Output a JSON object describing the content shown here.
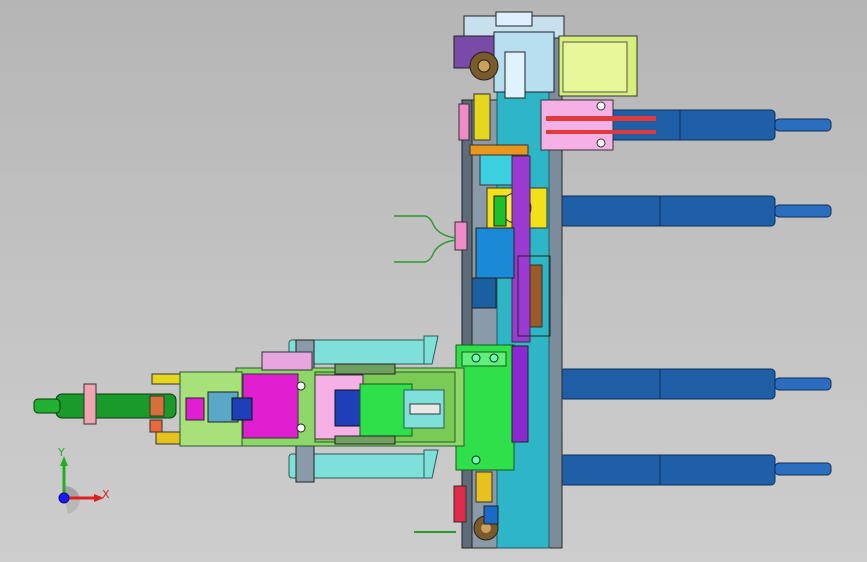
{
  "axis_triad": {
    "x_label": "X",
    "y_label": "Y",
    "x_color": "#e02020",
    "y_color": "#20b020",
    "origin_color": "#1a1aff"
  },
  "colors": {
    "rod_blue": "#1f5fa8",
    "frame_teal": "#2fb6c6",
    "plate_gray": "#8a9aa8",
    "yellow": "#f2e01a",
    "magenta": "#e020d0",
    "green": "#19c82a",
    "pink": "#f5b0e6",
    "cyan_block": "#7ee0d8",
    "purple": "#9a3ad0",
    "orange": "#e8961c"
  }
}
